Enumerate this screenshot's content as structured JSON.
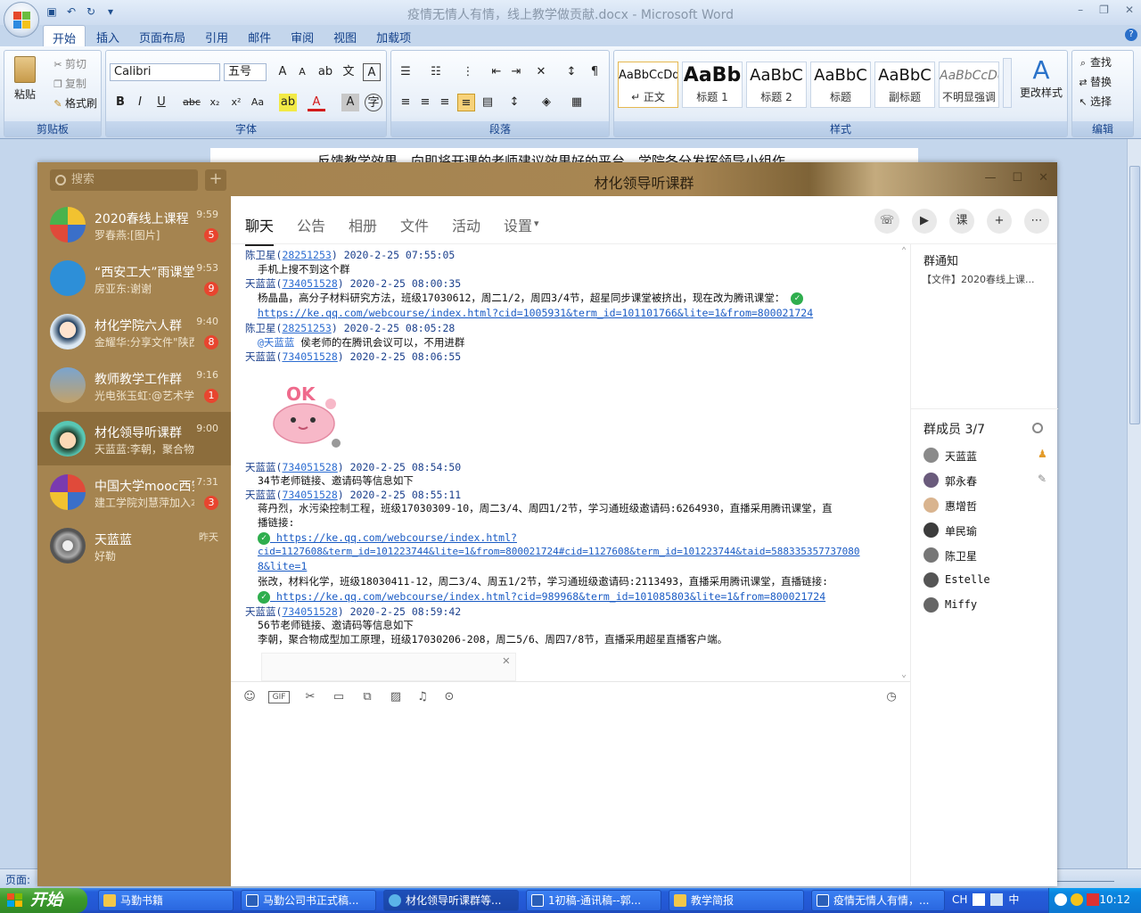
{
  "word": {
    "title": "疫情无情人有情，线上教学做贡献.docx - Microsoft Word",
    "tabs": [
      "开始",
      "插入",
      "页面布局",
      "引用",
      "邮件",
      "审阅",
      "视图",
      "加载项"
    ],
    "clipboard": {
      "paste": "粘贴",
      "cut": "剪切",
      "copy": "复制",
      "format_painter": "格式刷",
      "group": "剪贴板"
    },
    "font": {
      "name": "Calibri",
      "size": "五号",
      "group": "字体"
    },
    "paragraph_group": "段落",
    "styles": {
      "group": "样式",
      "items": [
        {
          "sample": "AaBbCcDd",
          "name": "↵ 正文"
        },
        {
          "sample": "AaBb",
          "name": "标题 1"
        },
        {
          "sample": "AaBbC",
          "name": "标题 2"
        },
        {
          "sample": "AaBbC",
          "name": "标题"
        },
        {
          "sample": "AaBbC",
          "name": "副标题"
        },
        {
          "sample": "AaBbCcDc",
          "name": "不明显强调"
        }
      ],
      "change": "更改样式"
    },
    "editing": {
      "find": "查找",
      "replace": "替换",
      "select": "选择",
      "group": "编辑"
    },
    "doc_line": "反馈教学效果，向即将开课的老师建议效果好的平台，学院各分发挥领导小组作",
    "status_page": "页面:"
  },
  "qq": {
    "title": "材化领导听课群",
    "search_placeholder": "搜索",
    "conversations": [
      {
        "name": "2020春线上课程",
        "sub": "罗春燕:[图片]",
        "time": "9:59",
        "badge": "5"
      },
      {
        "name": "“西安工大”雨课堂",
        "sub": "房亚东:谢谢",
        "time": "9:53",
        "badge": "9"
      },
      {
        "name": "材化学院六人群",
        "sub": "金耀华:分享文件\"陕西",
        "time": "9:40",
        "badge": "8"
      },
      {
        "name": "教师教学工作群",
        "sub": "光电张玉虹:@艺术学院",
        "time": "9:16",
        "badge": "1"
      },
      {
        "name": "材化领导听课群",
        "sub": "天蓝蓝:李朝，聚合物成型",
        "time": "9:00",
        "badge": ""
      },
      {
        "name": "中国大学mooc西安",
        "sub": "建工学院刘慧萍加入本",
        "time": "7:31",
        "badge": "3"
      },
      {
        "name": "天蓝蓝",
        "sub": "好勒",
        "time": "昨天",
        "badge": ""
      }
    ],
    "tabs": [
      "聊天",
      "公告",
      "相册",
      "文件",
      "活动",
      "设置"
    ],
    "messages": {
      "m1": {
        "name": "陈卫星",
        "qq": "28251253",
        "time": "2020-2-25 07:55:05",
        "text": "手机上搜不到这个群"
      },
      "m2": {
        "name": "天蓝蓝",
        "qq": "734051528",
        "time": "2020-2-25 08:00:35",
        "text": "杨晶晶，高分子材料研究方法，班级17030612，周二1/2，周四3/4节，超星同步课堂被挤出，现在改为腾讯课堂：",
        "link": "https://ke.qq.com/webcourse/index.html?cid=1005931&term_id=101101766&lite=1&from=800021724"
      },
      "m3": {
        "name": "陈卫星",
        "qq": "28251253",
        "time": "2020-2-25 08:05:28",
        "mention": "@天蓝蓝",
        "text": " 侯老师的在腾讯会议可以，不用进群"
      },
      "m4": {
        "name": "天蓝蓝",
        "qq": "734051528",
        "time": "2020-2-25 08:06:55",
        "sticker": "OK"
      },
      "m5": {
        "name": "天蓝蓝",
        "qq": "734051528",
        "time": "2020-2-25 08:54:50",
        "text": "34节老师链接、邀请码等信息如下"
      },
      "m6": {
        "name": "天蓝蓝",
        "qq": "734051528",
        "time": "2020-2-25 08:55:11",
        "text1": "蒋丹烈，水污染控制工程，班级17030309-10，周二3/4、周四1/2节，学习通班级邀请码:6264930，直播采用腾讯课堂，直",
        "text1b": "播链接:",
        "link1a": "https://ke.qq.com/webcourse/index.html?",
        "link1b": "cid=1127608&term_id=101223744&lite=1&from=800021724#cid=1127608&term_id=101223744&taid=588335357737080",
        "link1c": "8&lite=1",
        "text2": "张改，材料化学，班级18030411-12，周二3/4、周五1/2节，学习通班级邀请码:2113493，直播采用腾讯课堂，直播链接:",
        "link2": "https://ke.qq.com/webcourse/index.html?cid=989968&term_id=101085803&lite=1&from=800021724"
      },
      "m7": {
        "name": "天蓝蓝",
        "qq": "734051528",
        "time": "2020-2-25 08:59:42",
        "text1": "56节老师链接、邀请码等信息如下",
        "text2": "李朝，聚合物成型加工原理，班级17030206-208，周二5/6、周四7/8节，直播采用超星直播客户端。"
      }
    },
    "notice_title": "群通知",
    "notice_text": "【文件】2020春线上课...",
    "members_title": "群成员 3/7",
    "members": [
      "天蓝蓝",
      "郭永春",
      "惠增哲",
      "单民瑜",
      "陈卫星",
      "Estelle",
      "Miffy"
    ]
  },
  "taskbar": {
    "start": "开始",
    "tasks": [
      "马勤书籍",
      "马勤公司书正式稿...",
      "材化领导听课群等...",
      "1初稿-通讯稿--郭...",
      "教学简报",
      "疫情无情人有情，..."
    ],
    "ime": "CH",
    "ime2": "中",
    "clock": "10:12"
  }
}
